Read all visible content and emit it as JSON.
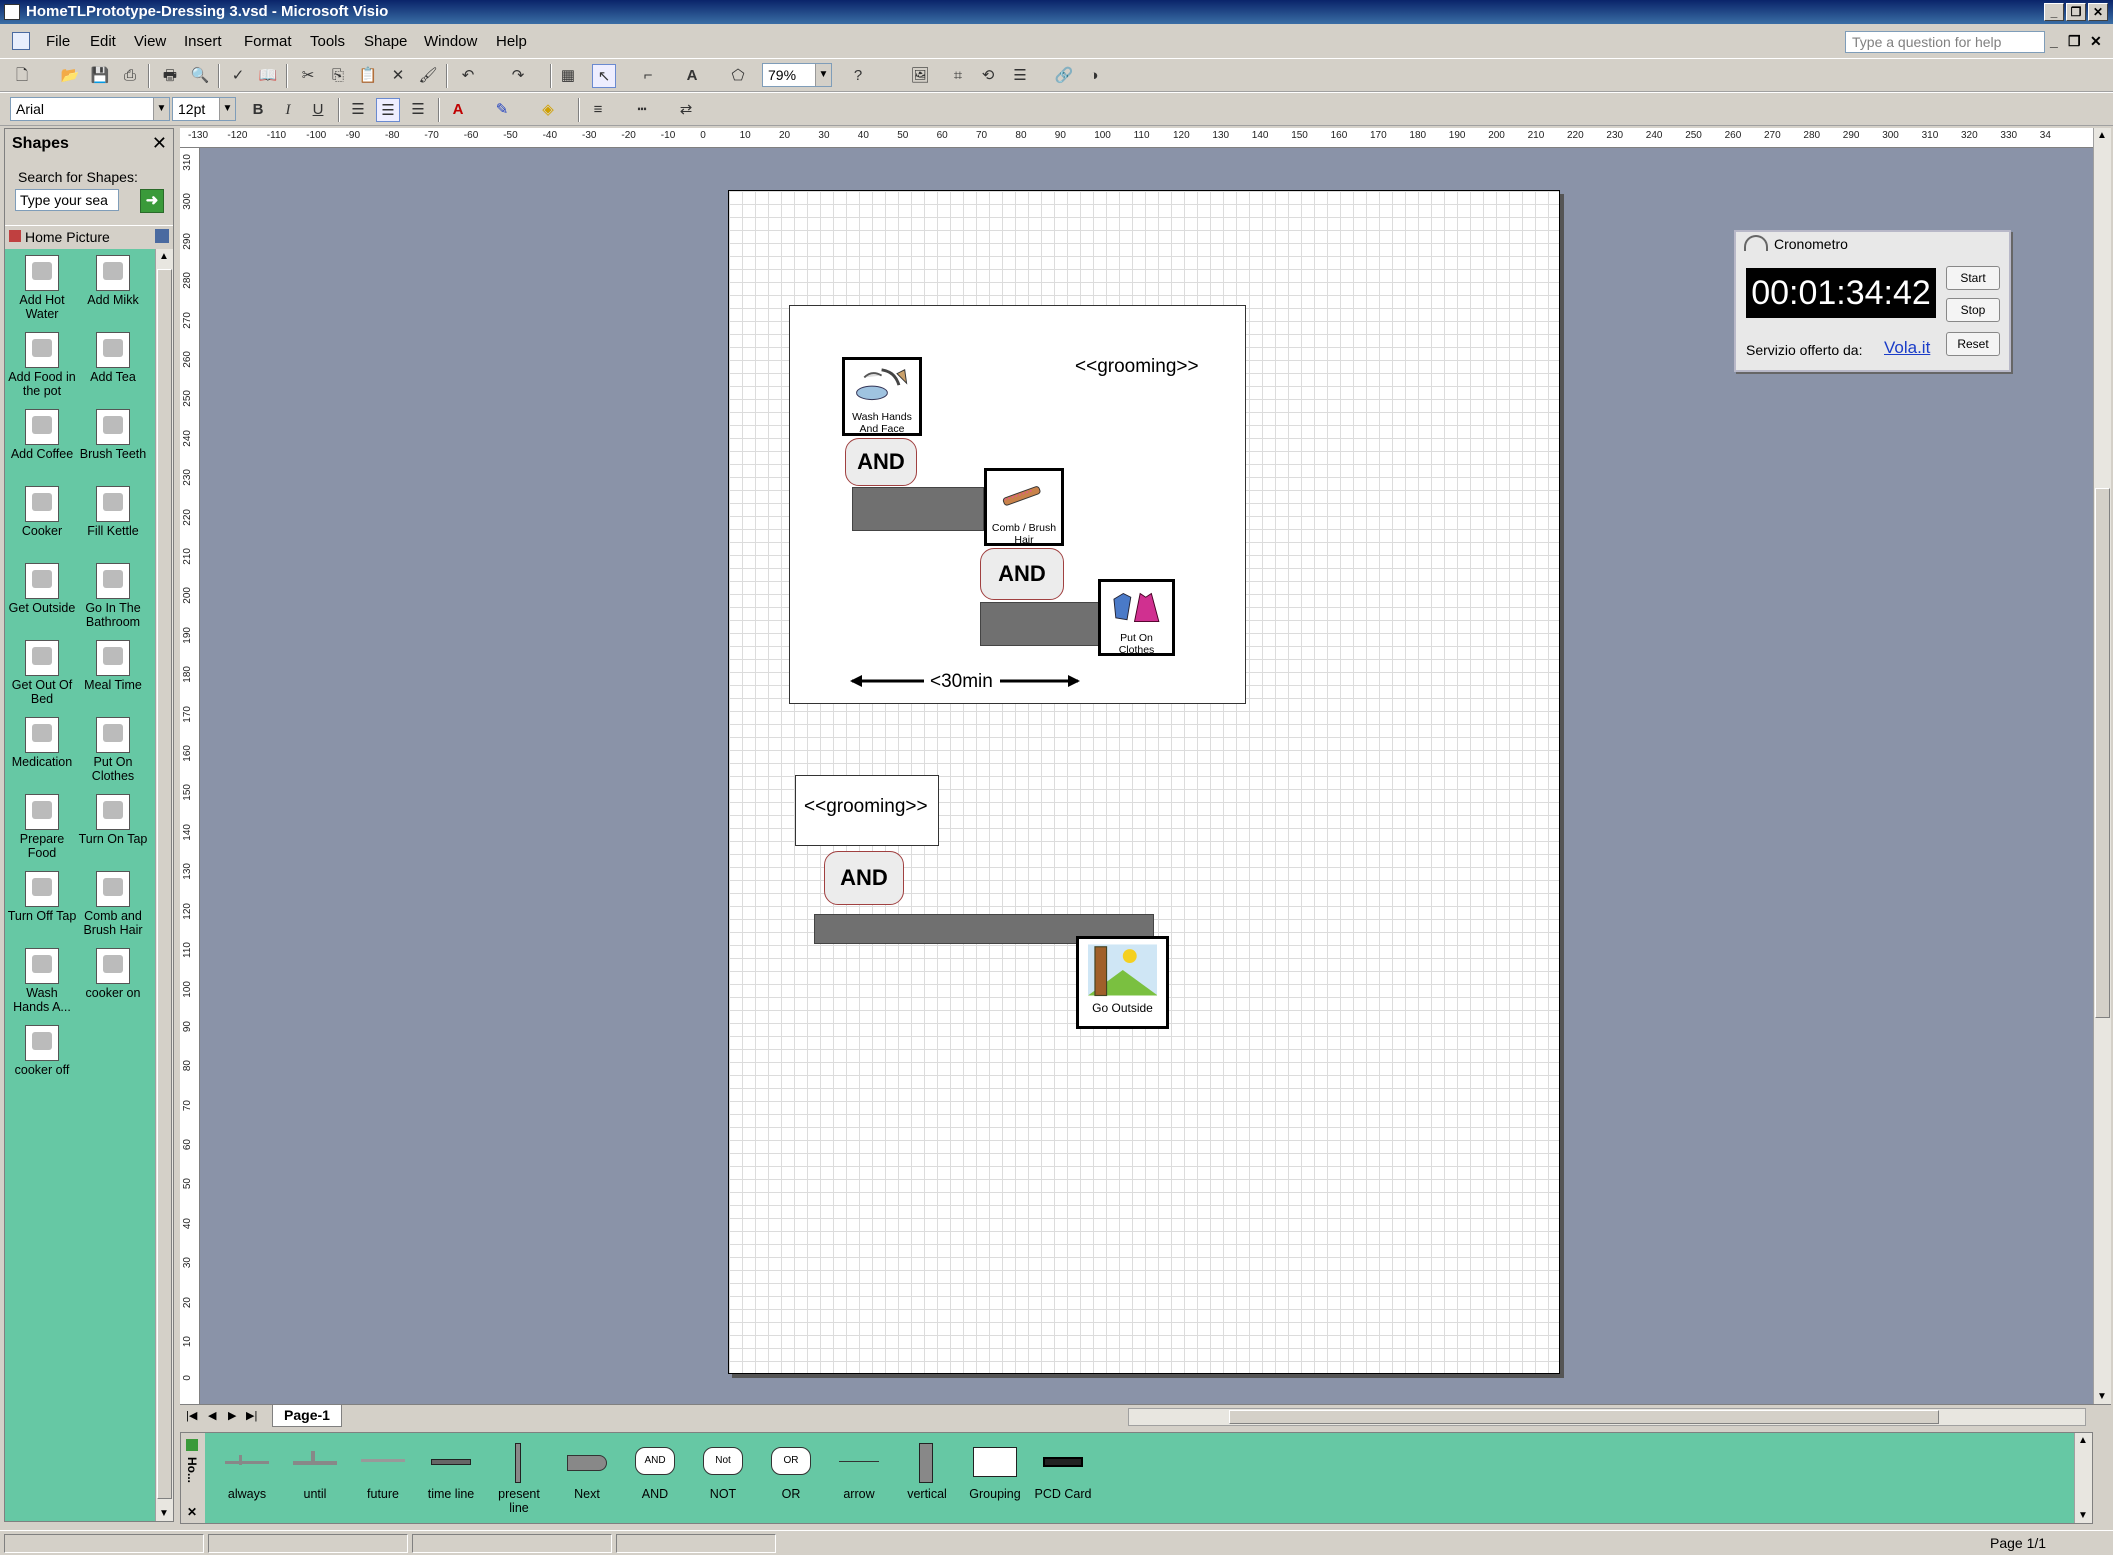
{
  "window": {
    "title": "HomeTLPrototype-Dressing 3.vsd - Microsoft Visio",
    "controls": [
      "_",
      "❐",
      "✕"
    ]
  },
  "menubar": {
    "items": [
      "File",
      "Edit",
      "View",
      "Insert",
      "Format",
      "Tools",
      "Shape",
      "Window",
      "Help"
    ],
    "help_placeholder": "Type a question for help"
  },
  "toolbar": {
    "zoom": "79%",
    "font": "Arial",
    "font_size": "12pt",
    "bold": "B",
    "italic": "I",
    "underline": "U"
  },
  "shapes_pane": {
    "title": "Shapes",
    "search_label": "Search for Shapes:",
    "search_placeholder": "Type your sea",
    "stencil_name": "Home Picture",
    "items": [
      {
        "label": "Add Hot Water"
      },
      {
        "label": "Add Mikk"
      },
      {
        "label": "Add Food in the pot"
      },
      {
        "label": "Add Tea"
      },
      {
        "label": "Add Coffee"
      },
      {
        "label": "Brush Teeth"
      },
      {
        "label": "Cooker"
      },
      {
        "label": "Fill Kettle"
      },
      {
        "label": "Get Outside"
      },
      {
        "label": "Go In The Bathroom"
      },
      {
        "label": "Get Out Of Bed"
      },
      {
        "label": "Meal Time"
      },
      {
        "label": "Medication"
      },
      {
        "label": "Put On Clothes"
      },
      {
        "label": "Prepare Food"
      },
      {
        "label": "Turn On Tap"
      },
      {
        "label": "Turn Off Tap"
      },
      {
        "label": "Comb and Brush Hair"
      },
      {
        "label": "Wash Hands A..."
      },
      {
        "label": "cooker on"
      },
      {
        "label": "cooker off"
      }
    ]
  },
  "ruler": {
    "h_labels": [
      "-130",
      "-120",
      "-110",
      "-100",
      "-90",
      "-80",
      "-70",
      "-60",
      "-50",
      "-40",
      "-30",
      "-20",
      "-10",
      "0",
      "10",
      "20",
      "30",
      "40",
      "50",
      "60",
      "70",
      "80",
      "90",
      "100",
      "110",
      "120",
      "130",
      "140",
      "150",
      "160",
      "170",
      "180",
      "190",
      "200",
      "210",
      "220",
      "230",
      "240",
      "250",
      "260",
      "270",
      "280",
      "290",
      "300",
      "310",
      "320",
      "330",
      "34"
    ],
    "v_labels": [
      "310",
      "300",
      "290",
      "280",
      "270",
      "260",
      "250",
      "240",
      "230",
      "220",
      "210",
      "200",
      "190",
      "180",
      "170",
      "160",
      "150",
      "140",
      "130",
      "120",
      "110",
      "100",
      "90",
      "80",
      "70",
      "60",
      "50",
      "40",
      "30",
      "20",
      "10",
      "0"
    ]
  },
  "diagram": {
    "group1": {
      "stereotype": "<<grooming>>",
      "card_wash": "Wash Hands And Face",
      "and1": "AND",
      "card_comb": "Comb / Brush Hair",
      "and2": "AND",
      "card_clothes": "Put On Clothes",
      "duration": "<30min"
    },
    "group2": {
      "stereotype": "<<grooming>>",
      "and": "AND",
      "card_outside": "Go Outside"
    }
  },
  "chronometer": {
    "title": "Cronometro",
    "time": "00:01:34:42",
    "start": "Start",
    "stop": "Stop",
    "reset": "Reset",
    "offer": "Servizio offerto da:",
    "link": "Vola.it"
  },
  "pagetabs": {
    "tab": "Page-1"
  },
  "bottom_stencil": {
    "name": "Ho...",
    "items": [
      {
        "label": "always"
      },
      {
        "label": "until"
      },
      {
        "label": "future"
      },
      {
        "label": "time line"
      },
      {
        "label": "present line"
      },
      {
        "label": "Next"
      },
      {
        "label": "AND",
        "shape_text": "AND"
      },
      {
        "label": "NOT",
        "shape_text": "Not"
      },
      {
        "label": "OR",
        "shape_text": "OR"
      },
      {
        "label": "arrow"
      },
      {
        "label": "vertical"
      },
      {
        "label": "Grouping"
      },
      {
        "label": "PCD Card"
      }
    ]
  },
  "statusbar": {
    "page": "Page 1/1"
  }
}
